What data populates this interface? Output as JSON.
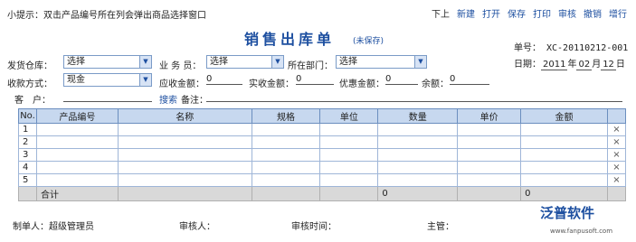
{
  "hint": "小提示：双击产品编号所在列会弹出商品选择窗口",
  "toolbar": {
    "items": [
      "下上",
      "新建",
      "打开",
      "保存",
      "打印",
      "审核",
      "撤销",
      "增行"
    ]
  },
  "title": "销售出库单",
  "status": "(未保存)",
  "doc_no": {
    "label": "单号：",
    "value": "XC-20110212-001"
  },
  "date": {
    "label": "日期：",
    "year": "2011",
    "y": "年",
    "month": "02",
    "m": "月",
    "day": "12",
    "d": "日"
  },
  "form": {
    "warehouse": {
      "label": "发货仓库：",
      "value": "选择"
    },
    "salesman": {
      "label": "业 务 员：",
      "value": "选择"
    },
    "department": {
      "label": "所在部门：",
      "value": "选择"
    },
    "pay_method": {
      "label": "收款方式：",
      "value": "现金"
    },
    "receivable": {
      "label": "应收金额：",
      "value": "0"
    },
    "received": {
      "label": "实收金额：",
      "value": "0"
    },
    "discount": {
      "label": "优惠金额：",
      "value": "0"
    },
    "balance": {
      "label": "余额：",
      "value": "0"
    },
    "customer": {
      "label": "客　户："
    },
    "search": "搜索",
    "remark": {
      "label": "备注："
    }
  },
  "table": {
    "headers": [
      "No.",
      "产品编号",
      "名称",
      "规格",
      "单位",
      "数量",
      "单价",
      "金额",
      ""
    ],
    "rows": [
      "1",
      "2",
      "3",
      "4",
      "5"
    ],
    "delete_glyph": "×",
    "total_label": "合计",
    "total_qty": "0",
    "total_amount": "0"
  },
  "footer": {
    "maker_label": "制单人：",
    "maker": "超级管理员",
    "reviewer_label": "审核人：",
    "review_time_label": "审核时间：",
    "manager_label": "主管："
  },
  "logo": {
    "text": "泛普软件",
    "url": "www.fanpusoft.com"
  }
}
